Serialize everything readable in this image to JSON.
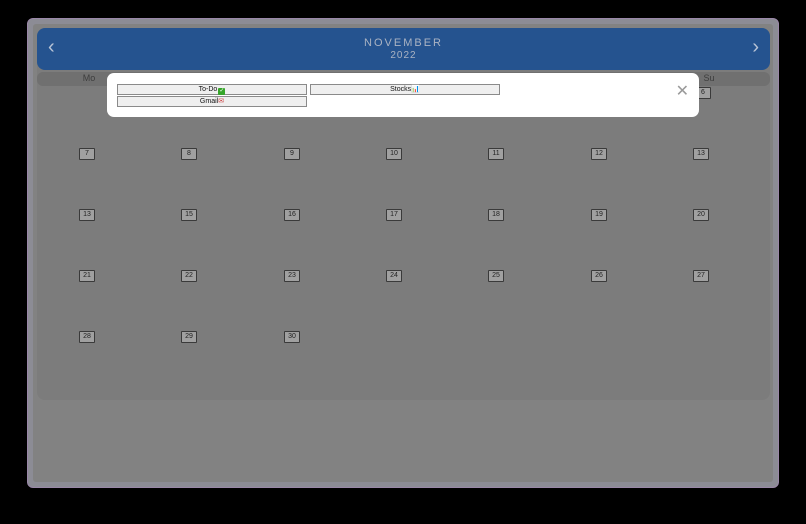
{
  "calendar": {
    "month": "NOVEMBER",
    "year": "2022",
    "prev_label": "‹",
    "next_label": "›",
    "weekdays": [
      "Mo",
      "Su"
    ],
    "days": [
      "6",
      "7",
      "8",
      "9",
      "10",
      "11",
      "12",
      "13",
      "13",
      "15",
      "16",
      "17",
      "18",
      "19",
      "20",
      "21",
      "22",
      "23",
      "24",
      "25",
      "26",
      "27",
      "28",
      "29",
      "30"
    ]
  },
  "modal": {
    "close_label": "✕",
    "apps": [
      {
        "label": "To-Do",
        "icon": "check-icon",
        "glyph": "✓"
      },
      {
        "label": "Stocks",
        "icon": "chart-icon",
        "glyph": "📊"
      },
      {
        "label": "Gmail",
        "icon": "mail-icon",
        "glyph": "✉"
      }
    ]
  }
}
